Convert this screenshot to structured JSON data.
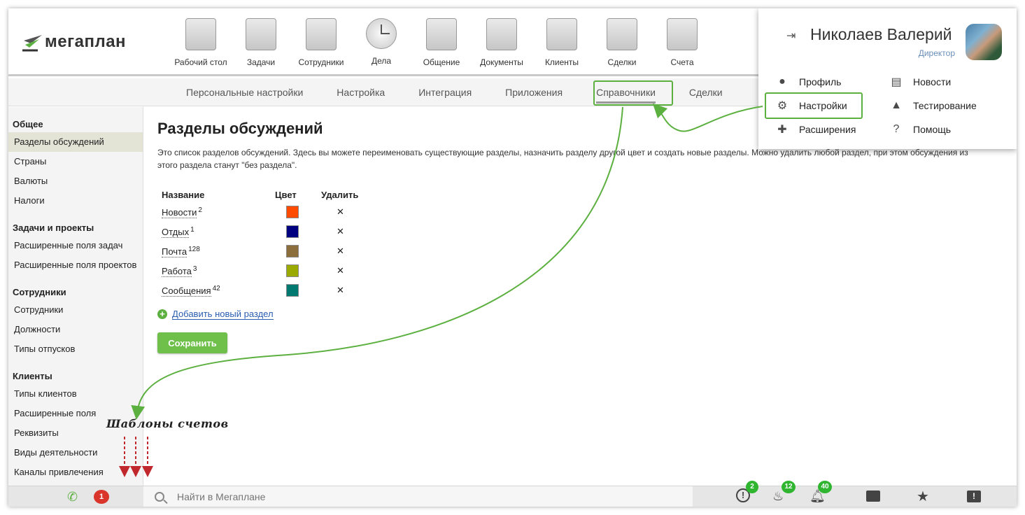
{
  "logo": {
    "text": "мегаплан"
  },
  "nav": [
    {
      "label": "Рабочий стол",
      "icon": "desktop-icon"
    },
    {
      "label": "Задачи",
      "icon": "tasks-icon"
    },
    {
      "label": "Сотрудники",
      "icon": "employees-icon"
    },
    {
      "label": "Дела",
      "icon": "clock-icon"
    },
    {
      "label": "Общение",
      "icon": "chat-icon"
    },
    {
      "label": "Документы",
      "icon": "documents-icon"
    },
    {
      "label": "Клиенты",
      "icon": "clients-icon"
    },
    {
      "label": "Сделки",
      "icon": "deals-icon"
    },
    {
      "label": "Счета",
      "icon": "invoices-icon"
    }
  ],
  "subnav": [
    {
      "label": "Персональные настройки"
    },
    {
      "label": "Настройка"
    },
    {
      "label": "Интеграция"
    },
    {
      "label": "Приложения"
    },
    {
      "label": "Справочники",
      "active": true
    },
    {
      "label": "Сделки"
    }
  ],
  "sidebar": {
    "groups": [
      {
        "title": "Общее",
        "items": [
          "Разделы обсуждений",
          "Страны",
          "Валюты",
          "Налоги"
        ]
      },
      {
        "title": "Задачи и проекты",
        "items": [
          "Расширенные поля задач",
          "Расширенные поля проектов"
        ]
      },
      {
        "title": "Сотрудники",
        "items": [
          "Сотрудники",
          "Должности",
          "Типы отпусков"
        ]
      },
      {
        "title": "Клиенты",
        "items": [
          "Типы клиентов",
          "Расширенные поля",
          "Реквизиты",
          "Виды деятельности",
          "Каналы привлечения"
        ]
      }
    ],
    "active_item": "Разделы обсуждений"
  },
  "main": {
    "title": "Разделы обсуждений",
    "description": "Это список разделов обсуждений. Здесь вы можете переименовать существующие разделы, назначить разделу другой цвет и создать новые разделы. Можно удалить любой раздел, при этом обсуждения из этого раздела станут \"без раздела\".",
    "columns": {
      "name": "Название",
      "color": "Цвет",
      "delete": "Удалить"
    },
    "sections": [
      {
        "name": "Новости",
        "count": "2",
        "color": "#ff4b00"
      },
      {
        "name": "Отдых",
        "count": "1",
        "color": "#000080"
      },
      {
        "name": "Почта",
        "count": "128",
        "color": "#8b6e3c"
      },
      {
        "name": "Работа",
        "count": "3",
        "color": "#9aaa00"
      },
      {
        "name": "Сообщения",
        "count": "42",
        "color": "#007a70"
      }
    ],
    "delete_glyph": "✕",
    "add_label": "Добавить новый раздел",
    "save_label": "Сохранить"
  },
  "bottombar": {
    "phone_badge": "1",
    "search_placeholder": "Найти в Мегаплане",
    "alerts_badge": "2",
    "hot_badge": "12",
    "notifications_badge": "40"
  },
  "user_menu": {
    "name": "Николаев Валерий",
    "role": "Директор",
    "items": [
      {
        "label": "Профиль",
        "icon": "person-icon"
      },
      {
        "label": "Новости",
        "icon": "clipboard-icon"
      },
      {
        "label": "Настройки",
        "icon": "gear-icon"
      },
      {
        "label": "Тестирование",
        "icon": "graduation-cap-icon"
      },
      {
        "label": "Расширения",
        "icon": "puzzle-icon"
      },
      {
        "label": "Помощь",
        "icon": "help-icon"
      }
    ]
  },
  "annotation": {
    "text": "Шаблоны счетов"
  },
  "colors": {
    "accent_green": "#5cb040",
    "badge_red": "#d9352b",
    "badge_green": "#2fb52f",
    "link_blue": "#2a5db0"
  }
}
